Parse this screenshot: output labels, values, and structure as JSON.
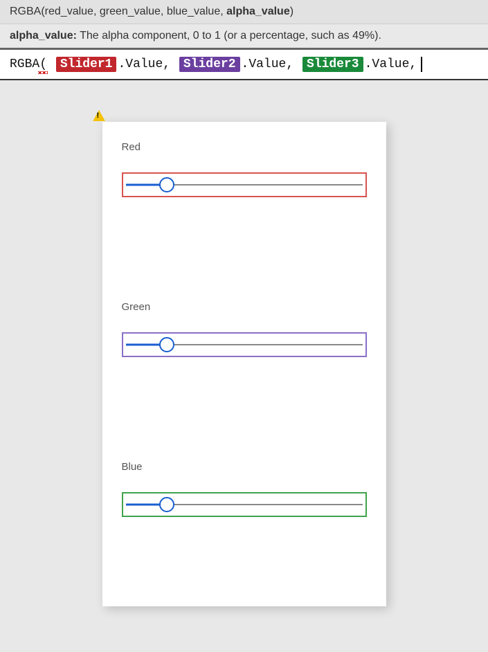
{
  "signature": {
    "fn": "RGBA",
    "params": [
      "red_value",
      "green_value",
      "blue_value",
      "alpha_value"
    ],
    "highlighted_param_index": 3
  },
  "param_help": {
    "name": "alpha_value:",
    "description": "The alpha component, 0 to 1 (or a percentage, such as 49%)."
  },
  "formula": {
    "fn": "RGBA",
    "open_paren": "(",
    "tokens": [
      {
        "chip": "Slider1",
        "chip_color": "chip-red",
        "suffix": ".Value,"
      },
      {
        "chip": "Slider2",
        "chip_color": "chip-purple",
        "suffix": ".Value,"
      },
      {
        "chip": "Slider3",
        "chip_color": "chip-green",
        "suffix": ".Value,"
      }
    ]
  },
  "sliders": [
    {
      "label": "Red",
      "box_class": "red",
      "value_percent": 18
    },
    {
      "label": "Green",
      "box_class": "purple",
      "value_percent": 18
    },
    {
      "label": "Blue",
      "box_class": "green",
      "value_percent": 18
    }
  ]
}
